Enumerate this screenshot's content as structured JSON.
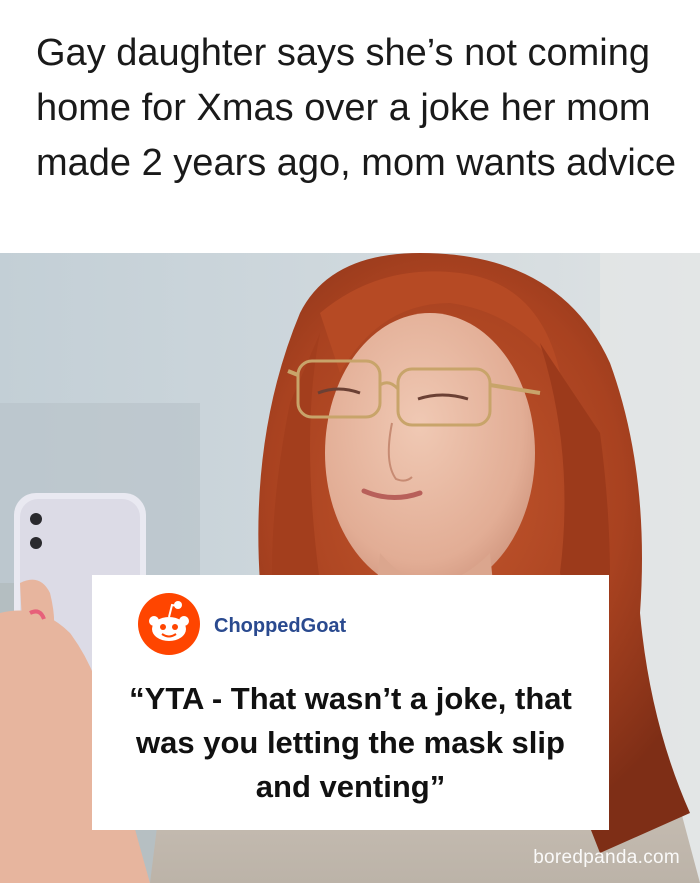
{
  "headline": "Gay daughter says she’s not coming home for Xmas over a joke her mom made 2 years ago, mom wants advice",
  "comment": {
    "username": "ChoppedGoat",
    "quote": "“YTA - That wasn’t a joke, that was you letting the mask slip and venting”",
    "avatar_icon": "reddit-snoo-icon",
    "avatar_color": "#ff4500"
  },
  "watermark": "boredpanda.com"
}
